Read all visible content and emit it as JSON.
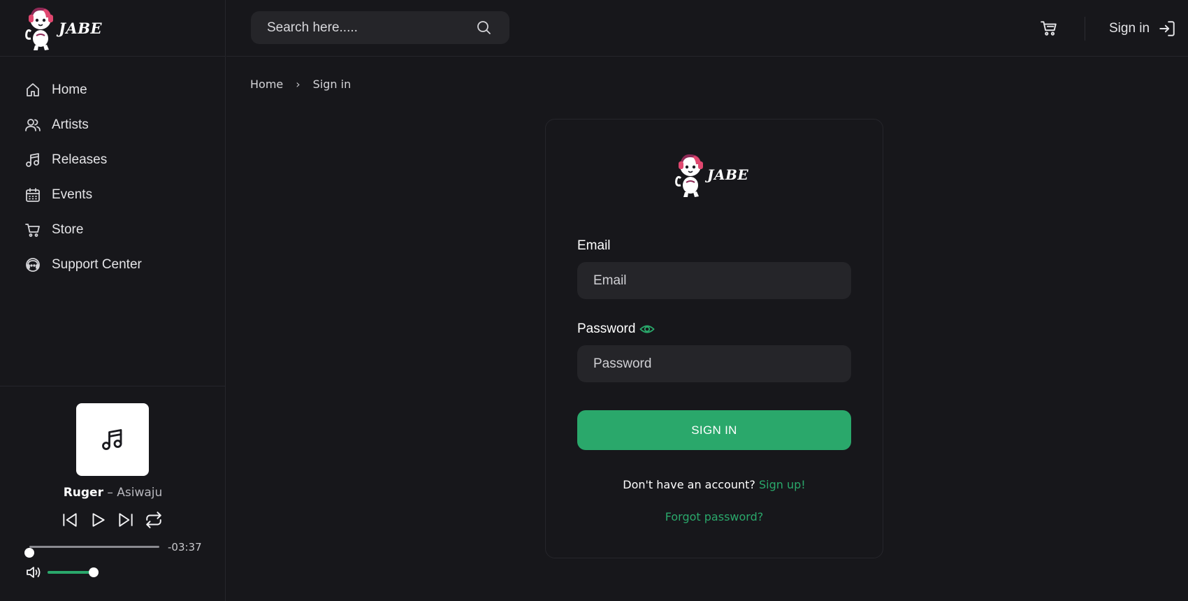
{
  "brand": {
    "name": "JABE",
    "logo_icon": "astronaut-cat-mascot-icon"
  },
  "sidebar": {
    "items": [
      {
        "label": "Home",
        "icon": "home-icon"
      },
      {
        "label": "Artists",
        "icon": "users-icon"
      },
      {
        "label": "Releases",
        "icon": "music-note-icon"
      },
      {
        "label": "Events",
        "icon": "calendar-icon"
      },
      {
        "label": "Store",
        "icon": "cart-icon"
      },
      {
        "label": "Support Center",
        "icon": "support-icon"
      }
    ]
  },
  "player": {
    "artist": "Ruger",
    "separator": " – ",
    "title": "Asiwaju",
    "time_remaining": "-03:37",
    "progress": 0.0,
    "volume": 0.9,
    "cover_icon": "music-note-icon"
  },
  "header": {
    "search_placeholder": "Search here.....",
    "signin_label": "Sign in",
    "cart_icon": "cart-icon",
    "signin_icon": "login-icon"
  },
  "breadcrumb": {
    "home": "Home",
    "separator": "›",
    "current": "Sign in"
  },
  "form": {
    "email_label": "Email",
    "email_placeholder": "Email",
    "email_value": "",
    "password_label": "Password",
    "password_placeholder": "Password",
    "password_value": "",
    "submit_label": "SIGN IN",
    "signup_prompt": "Don't have an account?",
    "signup_link": "Sign up!",
    "forgot_link": "Forgot password?"
  },
  "colors": {
    "background": "#17171b",
    "accent": "#2aa86b",
    "input_bg": "#252529",
    "border": "#26262b"
  }
}
